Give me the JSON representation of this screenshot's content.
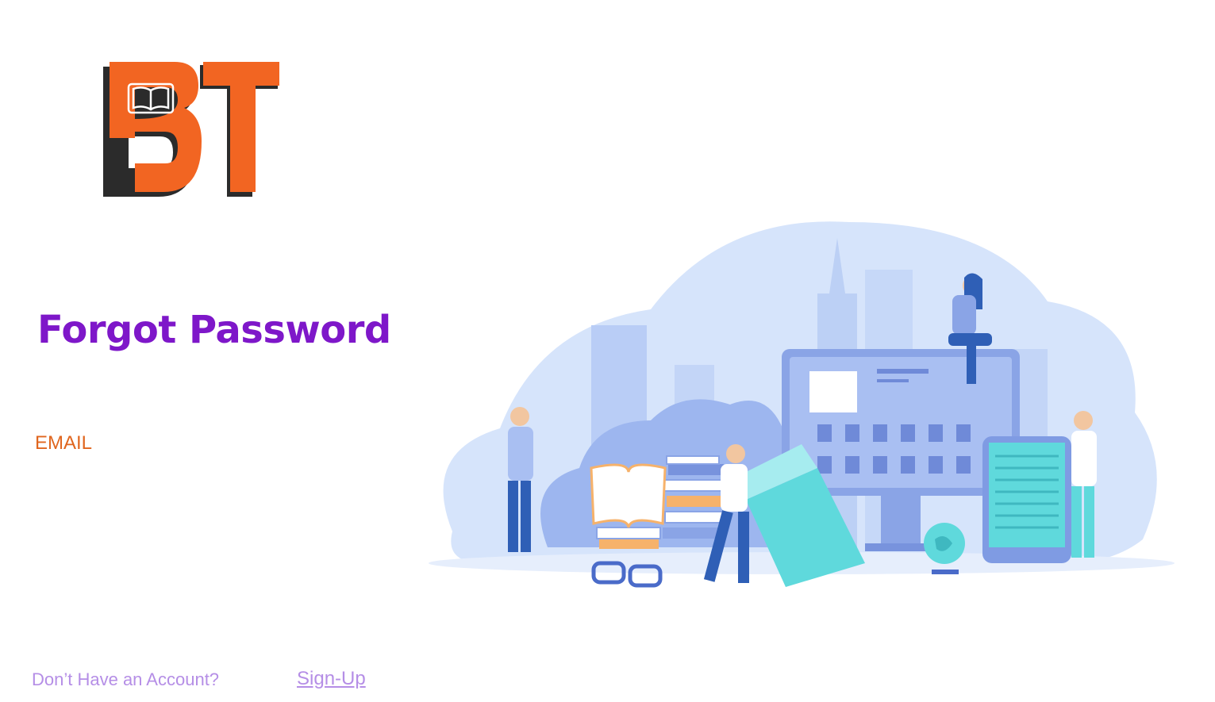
{
  "logo": {
    "name": "BT logo",
    "letters": "BT",
    "icon": "open-book-icon"
  },
  "page": {
    "title": "Forgot Password"
  },
  "form": {
    "email_label": "EMAIL",
    "email_value": ""
  },
  "footer": {
    "prompt_text": "Don’t Have an Account?",
    "signup_link": "Sign-Up"
  },
  "colors": {
    "brand_orange": "#f26522",
    "logo_shadow": "#2b2b2b",
    "title_purple": "#7e17c9",
    "label_orange": "#e0661f",
    "link_lavender": "#b58ee6",
    "illustration_blue": "#cfe0fb",
    "illustration_accent": "#5fd9dc"
  },
  "illustration": {
    "name": "online library illustration"
  }
}
